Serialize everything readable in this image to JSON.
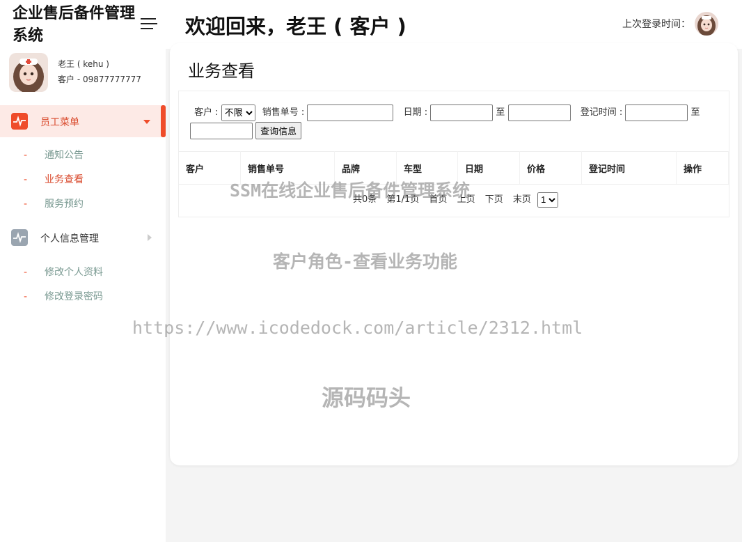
{
  "header": {
    "brand": "企业售后备件管理系统",
    "welcome": "欢迎回来，老王 ( 客户 )",
    "last_login_label": "上次登录时间："
  },
  "profile": {
    "name": "老王 ( kehu )",
    "role": "客户 - 09877777777"
  },
  "sidebar": {
    "groups": [
      {
        "label": "员工菜单",
        "icon": "pulse-icon",
        "active": true,
        "items": [
          {
            "label": "通知公告",
            "active": false
          },
          {
            "label": "业务查看",
            "active": true
          },
          {
            "label": "服务预约",
            "active": false
          }
        ]
      },
      {
        "label": "个人信息管理",
        "icon": "pulse-icon",
        "active": false,
        "items": [
          {
            "label": "修改个人资料",
            "active": false
          },
          {
            "label": "修改登录密码",
            "active": false
          }
        ]
      }
    ]
  },
  "page": {
    "title": "业务查看"
  },
  "filter": {
    "customer_label": "客户 :",
    "customer_value": "不限",
    "order_label": "销售单号 :",
    "date_label": "日期 :",
    "to_label": "至",
    "regtime_label": "登记时间 :",
    "to_label2": "至",
    "query_button": "查询信息"
  },
  "table": {
    "columns": [
      "客户",
      "销售单号",
      "品牌",
      "车型",
      "日期",
      "价格",
      "登记时间",
      "操作"
    ]
  },
  "pager": {
    "total": "共0条",
    "page_info": "第1/1页",
    "first": "首页",
    "prev": "上页",
    "next": "下页",
    "last": "末页",
    "page_select": "1"
  },
  "watermarks": {
    "line1": "SSM在线企业售后备件管理系统",
    "line2": "客户角色-查看业务功能",
    "line3": "https://www.icodedock.com/article/2312.html",
    "line4": "源码码头"
  },
  "colors": {
    "accent": "#ef4c2a",
    "active_bg": "#fdeae6",
    "submenu_text": "#7a9a92"
  }
}
